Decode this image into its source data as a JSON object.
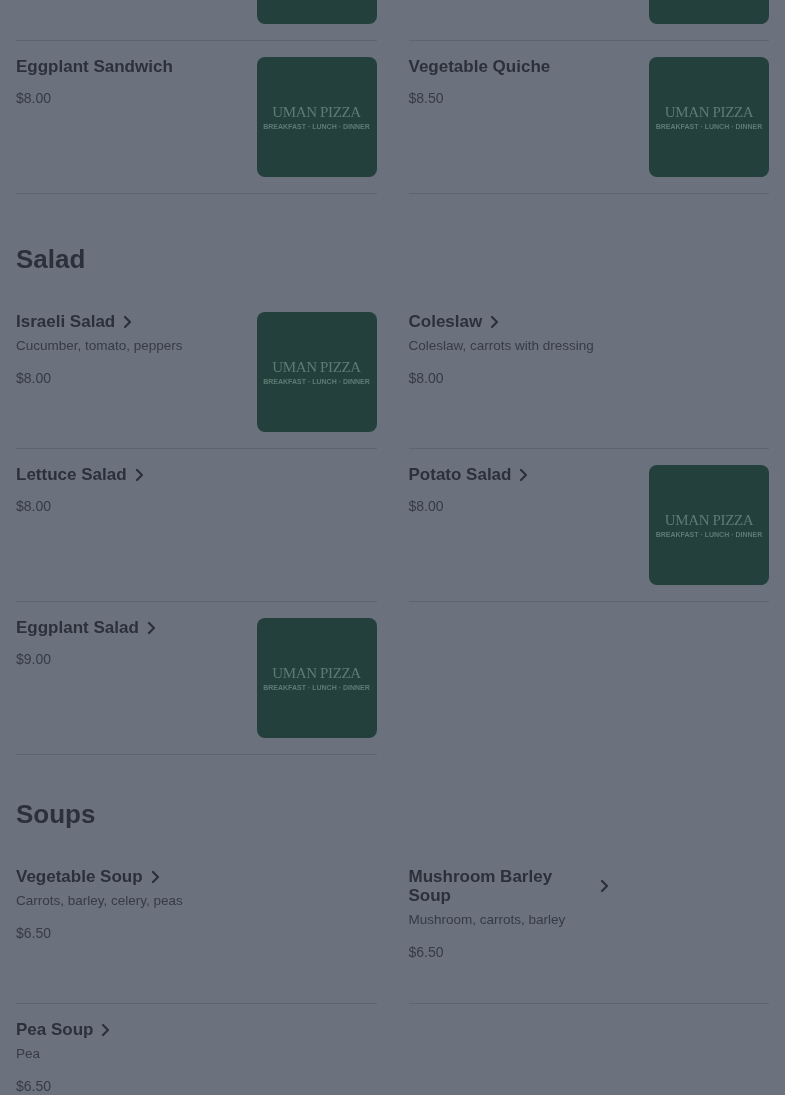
{
  "sections": [
    {
      "items": [
        {
          "has_image": true
        },
        {
          "has_image": true
        },
        {
          "name": "Eggplant Sandwich",
          "price": "$8.00",
          "has_details": false,
          "has_image": true,
          "logo": {
            "title": "UMAN PIZZA",
            "tagline": "BREAKFAST · LUNCH · DINNER"
          }
        },
        {
          "name": "Vegetable Quiche",
          "price": "$8.50",
          "has_details": false,
          "has_image": true,
          "logo": {
            "title": "UMAN PIZZA",
            "tagline": "BREAKFAST · LUNCH · DINNER"
          }
        }
      ]
    },
    {
      "title": "Salad",
      "items": [
        {
          "name": "Israeli Salad",
          "description": "Cucumber, tomato, peppers",
          "price": "$8.00",
          "has_details": true,
          "has_image": true,
          "logo": {
            "title": "UMAN PIZZA",
            "tagline": "BREAKFAST · LUNCH · DINNER"
          }
        },
        {
          "name": "Coleslaw",
          "description": "Coleslaw, carrots with dressing",
          "price": "$8.00",
          "has_details": true,
          "has_image": false
        },
        {
          "name": "Lettuce Salad",
          "price": "$8.00",
          "has_details": true,
          "has_image": false
        },
        {
          "name": "Potato Salad",
          "price": "$8.00",
          "has_details": true,
          "has_image": true,
          "logo": {
            "title": "UMAN PIZZA",
            "tagline": "BREAKFAST · LUNCH · DINNER"
          }
        },
        {
          "name": "Eggplant Salad",
          "price": "$9.00",
          "has_details": true,
          "has_image": true,
          "logo": {
            "title": "UMAN PIZZA",
            "tagline": "BREAKFAST · LUNCH · DINNER"
          }
        }
      ]
    },
    {
      "title": "Soups",
      "items": [
        {
          "name": "Vegetable Soup",
          "description": "Carrots, barley, celery, peas",
          "price": "$6.50",
          "has_details": true,
          "has_image": false
        },
        {
          "name": "Mushroom Barley Soup",
          "description": "Mushroom, carrots, barley",
          "price": "$6.50",
          "has_details": true,
          "has_image": false
        },
        {
          "name": "Pea Soup",
          "description": "Pea",
          "price": "$6.50",
          "has_details": true,
          "has_image": false
        }
      ]
    }
  ]
}
